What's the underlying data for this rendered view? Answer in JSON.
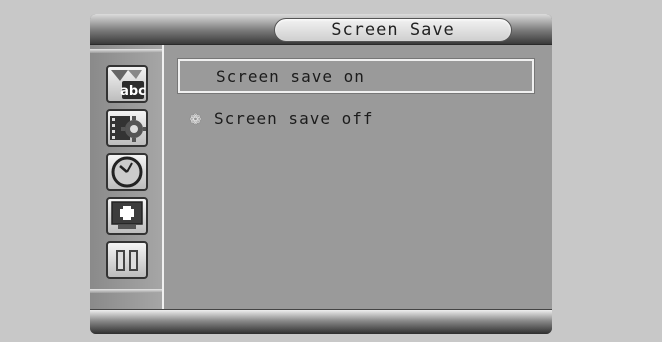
{
  "header": {
    "title": "Screen Save"
  },
  "sidebar": {
    "items": [
      {
        "icon": "language-icon",
        "label": "abc"
      },
      {
        "icon": "video-settings-icon"
      },
      {
        "icon": "clock-icon"
      },
      {
        "icon": "display-add-icon"
      },
      {
        "icon": "pause-bars-icon"
      }
    ]
  },
  "menu": {
    "items": [
      {
        "label": "Screen save on",
        "selected": true,
        "marked": false
      },
      {
        "label": "Screen save off",
        "selected": false,
        "marked": true
      }
    ],
    "marker_glyph": "❁"
  },
  "colors": {
    "panel": "#9a9a9a",
    "selection_border": "#f0f0f0"
  }
}
